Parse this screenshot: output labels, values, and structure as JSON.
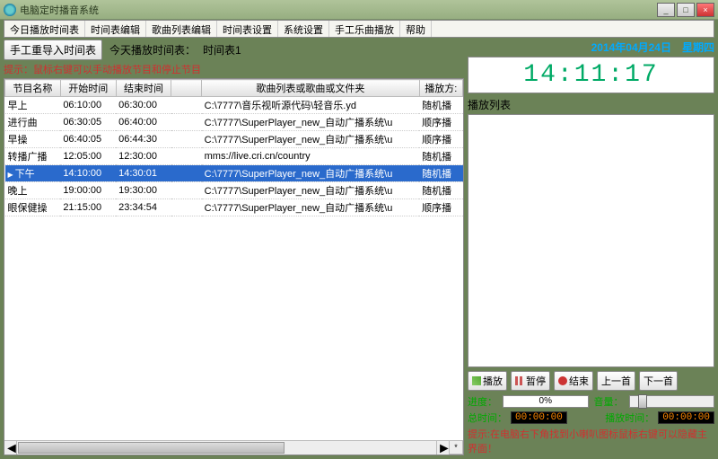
{
  "window_title": "电脑定时播音系统",
  "menu": [
    "今日播放时间表",
    "时间表编辑",
    "歌曲列表编辑",
    "时间表设置",
    "系统设置",
    "手工乐曲播放",
    "帮助"
  ],
  "reimport_btn": "手工重导入时间表",
  "today_label": "今天播放时间表：",
  "today_value": "时间表1",
  "hint1": "提示：鼠标右键可以手动播放节目和停止节目",
  "columns": [
    "节目名称",
    "开始时间",
    "结束时间",
    "",
    "歌曲列表或歌曲或文件夹",
    "播放方:"
  ],
  "rows": [
    {
      "name": "早上",
      "start": "06:10:00",
      "end": "06:30:00",
      "path": "C:\\7777\\音乐视听源代码\\轻音乐.yd",
      "mode": "随机播"
    },
    {
      "name": "进行曲",
      "start": "06:30:05",
      "end": "06:40:00",
      "path": "C:\\7777\\SuperPlayer_new_自动广播系统\\u",
      "mode": "顺序播"
    },
    {
      "name": "早操",
      "start": "06:40:05",
      "end": "06:44:30",
      "path": "C:\\7777\\SuperPlayer_new_自动广播系统\\u",
      "mode": "顺序播"
    },
    {
      "name": "转播广播",
      "start": "12:05:00",
      "end": "12:30:00",
      "path": "mms://live.cri.cn/country",
      "mode": "随机播"
    },
    {
      "name": "下午",
      "start": "14:10:00",
      "end": "14:30:01",
      "path": "C:\\7777\\SuperPlayer_new_自动广播系统\\u",
      "mode": "随机播",
      "selected": true
    },
    {
      "name": "晚上",
      "start": "19:00:00",
      "end": "19:30:00",
      "path": "C:\\7777\\SuperPlayer_new_自动广播系统\\u",
      "mode": "随机播"
    },
    {
      "name": "眼保健操",
      "start": "21:15:00",
      "end": "23:34:54",
      "path": "C:\\7777\\SuperPlayer_new_自动广播系统\\u",
      "mode": "顺序播"
    }
  ],
  "date_str": "2014年04月24日　星期四",
  "clock": "14:11:17",
  "playlist_label": "播放列表",
  "controls": {
    "play": "播放",
    "pause": "暂停",
    "stop": "结束",
    "prev": "上一首",
    "next": "下一首"
  },
  "progress_label": "进度：",
  "progress_value": "0%",
  "volume_label": "音量：",
  "total_time_label": "总时间：",
  "total_time": "00:00:00",
  "play_time_label": "播放时间：",
  "play_time": "00:00:00",
  "hint2": "提示:在电脑右下角找到小喇叭图标鼠标右键可以隐藏主界面！"
}
